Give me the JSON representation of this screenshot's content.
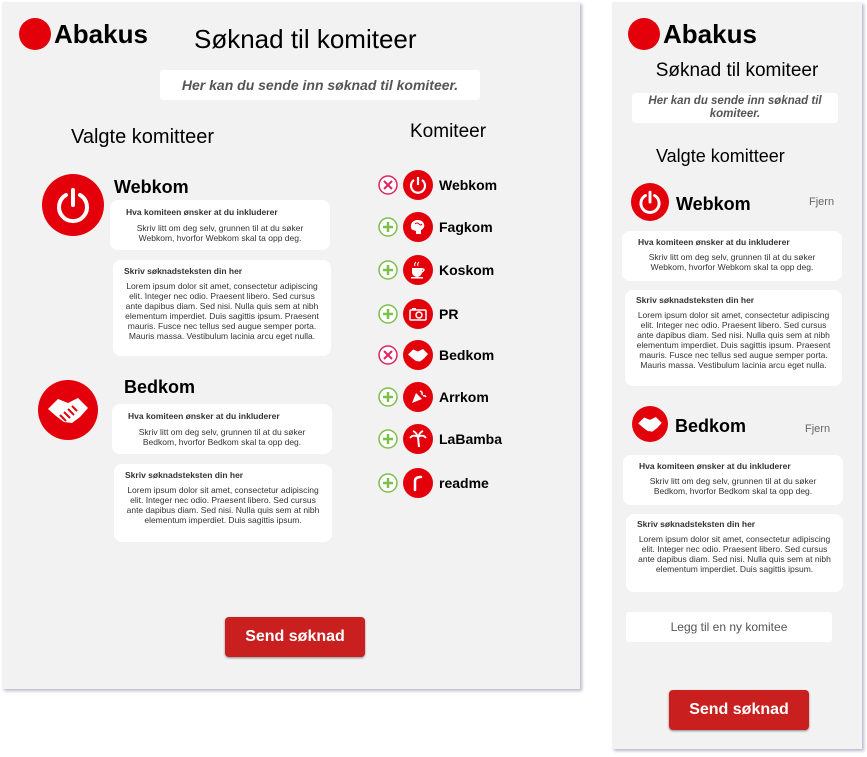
{
  "desktop": {
    "logo": "Abakus",
    "title": "Søknad til komiteer",
    "subtitle": "Her kan du sende inn søknad til komiteer.",
    "selected_heading": "Valgte komitteer",
    "committees_heading": "Komiteer",
    "selected": [
      {
        "name": "Webkom",
        "icon": "power-icon",
        "include_heading": "Hva komiteen ønsker at du inkluderer",
        "include_text": "Skriv litt om  deg selv, grunnen til at du søker\nWebkom, hvorfor Webkom skal ta opp deg.",
        "app_heading": "Skriv søknadsteksten din her",
        "app_text": "Lorem ipsum dolor sit amet, consectetur adipiscing\nelit. Integer nec odio. Praesent libero. Sed cursus\nante dapibus diam. Sed nisi. Nulla quis sem at nibh\nelementum imperdiet. Duis sagittis ipsum. Praesent\nmauris. Fusce nec tellus sed augue semper porta.\nMauris massa. Vestibulum lacinia arcu eget nulla."
      },
      {
        "name": "Bedkom",
        "icon": "handshake-icon",
        "include_heading": "Hva komiteen ønsker at du inkluderer",
        "include_text": "Skriv litt om  deg selv, grunnen til at du søker\nBedkom, hvorfor Bedkom skal ta opp deg.",
        "app_heading": "Skriv søknadsteksten din her",
        "app_text": "Lorem ipsum dolor sit amet, consectetur adipiscing\nelit. Integer nec odio. Praesent libero. Sed cursus\nante dapibus diam. Sed nisi. Nulla quis sem at nibh\nelementum imperdiet. Duis sagittis ipsum."
      }
    ],
    "committees": [
      {
        "name": "Webkom",
        "icon": "power-icon",
        "action": "remove"
      },
      {
        "name": "Fagkom",
        "icon": "brain-icon",
        "action": "add"
      },
      {
        "name": "Koskom",
        "icon": "coffee-cup-icon",
        "action": "add"
      },
      {
        "name": "PR",
        "icon": "camera-icon",
        "action": "add"
      },
      {
        "name": "Bedkom",
        "icon": "handshake-icon",
        "action": "remove"
      },
      {
        "name": "Arrkom",
        "icon": "party-icon",
        "action": "add"
      },
      {
        "name": "LaBamba",
        "icon": "palm-tree-icon",
        "action": "add"
      },
      {
        "name": "readme",
        "icon": "readme-r-icon",
        "action": "add"
      }
    ],
    "submit": "Send søknad"
  },
  "mobile": {
    "logo": "Abakus",
    "title": "Søknad til komiteer",
    "subtitle": "Her kan du sende inn søknad til\nkomiteer.",
    "selected_heading": "Valgte komitteer",
    "remove_label": "Fjern",
    "selected": [
      {
        "name": "Webkom",
        "include_heading": "Hva komiteen ønsker at du inkluderer",
        "include_text": "Skriv litt om  deg selv, grunnen til at du søker\nWebkom, hvorfor Webkom skal ta opp deg.",
        "app_heading": "Skriv søknadsteksten din her",
        "app_text": "Lorem ipsum dolor sit amet, consectetur adipiscing\nelit. Integer nec odio. Praesent libero. Sed cursus\nante dapibus diam. Sed nisi. Nulla quis sem at nibh\nelementum imperdiet. Duis sagittis ipsum. Praesent\nmauris. Fusce nec tellus sed augue semper porta.\nMauris massa. Vestibulum lacinia arcu eget nulla."
      },
      {
        "name": "Bedkom",
        "include_heading": "Hva komiteen ønsker at du inkluderer",
        "include_text": "Skriv litt om  deg selv, grunnen til at du søker\nBedkom, hvorfor Bedkom skal ta opp deg.",
        "app_heading": "Skriv søknadsteksten din her",
        "app_text": "Lorem ipsum dolor sit amet, consectetur adipiscing\nelit. Integer nec odio. Praesent libero. Sed cursus\nante dapibus diam. Sed nisi. Nulla quis sem at nibh\nelementum imperdiet. Duis sagittis ipsum."
      }
    ],
    "add_placeholder": "Legg til en ny komitee",
    "submit": "Send søknad"
  },
  "colors": {
    "brand": "#e3000b",
    "button": "#c9201f",
    "remove": "#e0245e",
    "add": "#7cc04b"
  }
}
